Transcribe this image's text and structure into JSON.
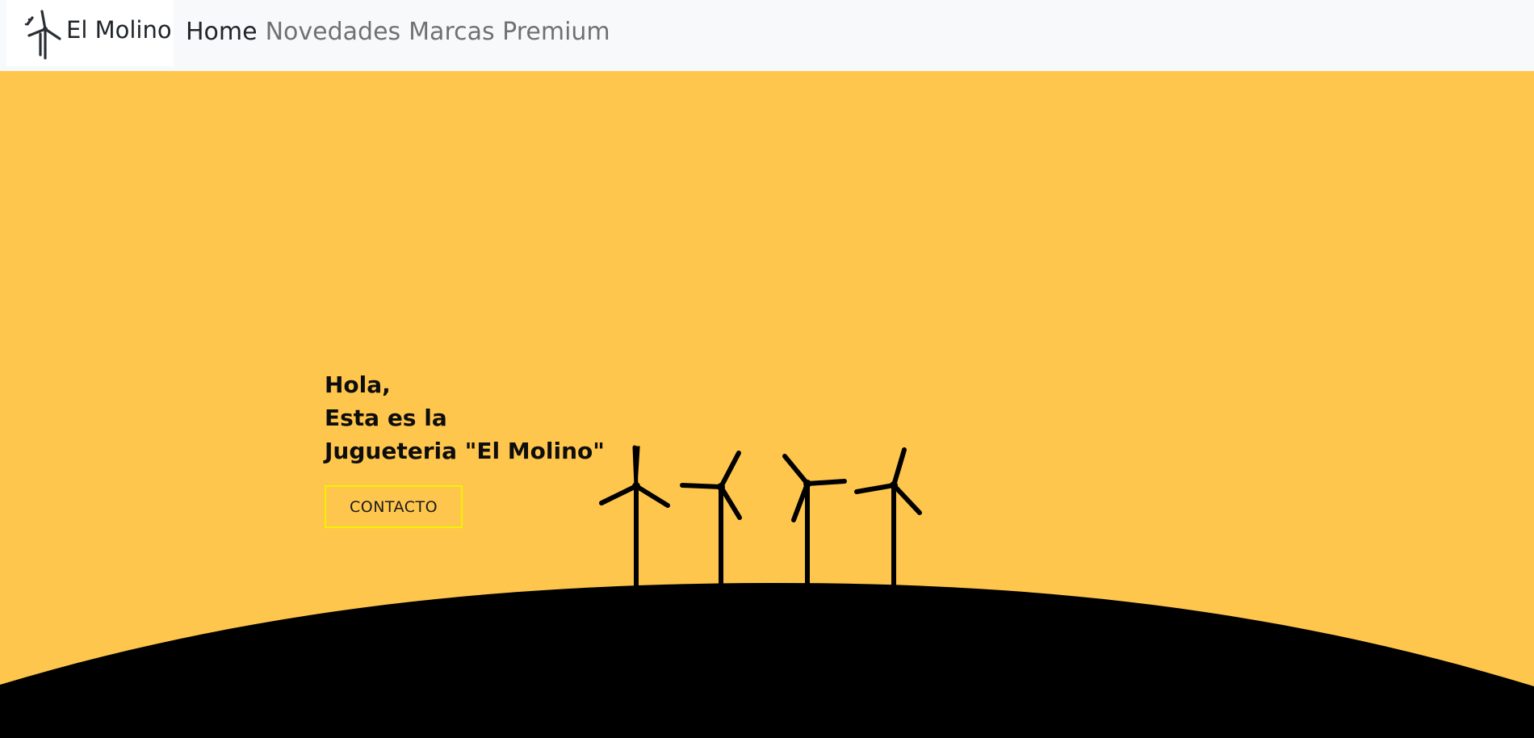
{
  "brand": {
    "name": "El Molino",
    "logo_icon": "wind-turbine-icon"
  },
  "nav": {
    "items": [
      {
        "label": "Home",
        "active": true
      },
      {
        "label": "Novedades",
        "active": false
      },
      {
        "label": "Marcas Premium",
        "active": false
      }
    ]
  },
  "hero": {
    "line1": "Hola,",
    "line2": "Esta es la",
    "line3": "Jugueteria \"El Molino\"",
    "cta_label": "CONTACTO",
    "background_color": "#ffc64d",
    "hill_color": "#000000",
    "cta_border_color": "#f2f200",
    "illustration_icon": "wind-turbines-on-hill-icon"
  }
}
